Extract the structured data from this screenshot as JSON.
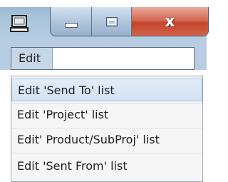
{
  "window": {
    "minimize_icon": "minimize-icon",
    "maximize_icon": "maximize-icon",
    "close_icon": "close-icon",
    "close_glyph": "x",
    "app_icon": "computer-icon"
  },
  "menubar": {
    "edit_label": "Edit"
  },
  "dropdown": {
    "items": [
      {
        "label": "Edit 'Send To' list",
        "highlighted": true
      },
      {
        "label": "Edit 'Project' list",
        "highlighted": false
      },
      {
        "label": "Edit' Product/SubProj' list",
        "highlighted": false
      },
      {
        "label": "Edit 'Sent From' list",
        "highlighted": false
      }
    ]
  },
  "colors": {
    "titlebar": "#a9c3dc",
    "close_button": "#c3452c",
    "highlight": "#d3e2f2"
  }
}
